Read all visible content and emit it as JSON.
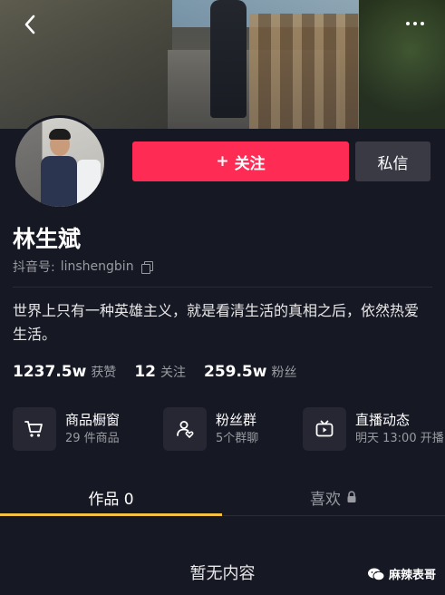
{
  "profile": {
    "name": "林生斌",
    "douyin_id_label": "抖音号:",
    "douyin_id": "linshengbin",
    "bio": "世界上只有一种英雄主义，就是看清生活的真相之后，依然热爱生活。"
  },
  "actions": {
    "follow_label": "关注",
    "follow_plus": "+",
    "message_label": "私信"
  },
  "stats": [
    {
      "value": "1237.5w",
      "label": "获赞"
    },
    {
      "value": "12",
      "label": "关注"
    },
    {
      "value": "259.5w",
      "label": "粉丝"
    }
  ],
  "features": {
    "shop": {
      "title": "商品橱窗",
      "sub": "29 件商品",
      "icon": "cart-icon"
    },
    "fans": {
      "title": "粉丝群",
      "sub": "5个群聊",
      "icon": "group-icon"
    },
    "live": {
      "title": "直播动态",
      "sub": "明天 13:00 开播",
      "icon": "tv-icon"
    }
  },
  "tabs": {
    "works": "作品 0",
    "likes": "喜欢"
  },
  "empty_text": "暂无内容",
  "watermark": "麻辣表哥",
  "colors": {
    "background": "#161823",
    "follow_button": "#fe2c55",
    "tab_indicator": "#f6c244",
    "secondary_text": "#9a9ba2"
  }
}
